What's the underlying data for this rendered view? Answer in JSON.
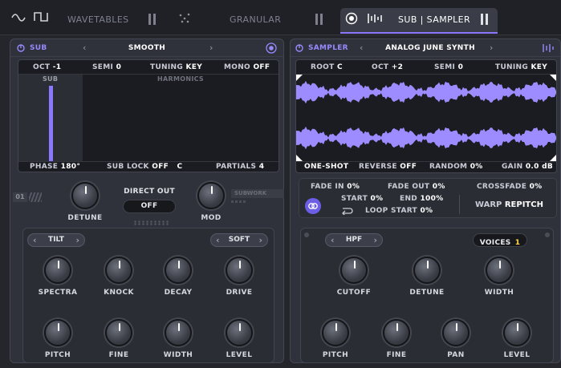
{
  "tabs": {
    "wavetables": "WAVETABLES",
    "granular": "GRANULAR",
    "sub_sampler": "SUB | SAMPLER"
  },
  "sub": {
    "title": "SUB",
    "preset": "SMOOTH",
    "oct_label": "OCT",
    "oct": "-1",
    "semi_label": "SEMI",
    "semi": "0",
    "tuning_label": "TUNING",
    "tuning": "KEY",
    "mono_label": "MONO",
    "mono": "OFF",
    "sub_label": "SUB",
    "harmonics_label": "HARMONICS",
    "phase_label": "PHASE",
    "phase": "180°",
    "sublock_label": "SUB LOCK",
    "sublock": "OFF",
    "sublock_key": "C",
    "partials_label": "PARTIALS",
    "partials": "4",
    "detune": "DETUNE",
    "direct_out": "DIRECT OUT",
    "direct_out_value": "OFF",
    "mod": "MOD",
    "slot": "01",
    "subwork": "SUBWORK"
  },
  "sub_fx": {
    "filter": "TILT",
    "shape": "SOFT",
    "knobs1": [
      "SPECTRA",
      "KNOCK",
      "DECAY",
      "DRIVE"
    ],
    "knobs2": [
      "PITCH",
      "FINE",
      "WIDTH",
      "LEVEL"
    ]
  },
  "sampler": {
    "title": "SAMPLER",
    "preset": "ANALOG JUNE SYNTH",
    "root_label": "ROOT",
    "root": "C",
    "oct_label": "OCT",
    "oct": "+2",
    "semi_label": "SEMI",
    "semi": "0",
    "tuning_label": "TUNING",
    "tuning": "KEY",
    "oneshot": "ONE-SHOT",
    "reverse_label": "REVERSE",
    "reverse": "OFF",
    "random_label": "RANDOM",
    "random": "0%",
    "gain_label": "GAIN",
    "gain": "0.0 dB",
    "fadein_label": "FADE IN",
    "fadein": "0%",
    "fadeout_label": "FADE OUT",
    "fadeout": "0%",
    "crossfade_label": "CROSSFADE",
    "crossfade": "0%",
    "start_label": "START",
    "start": "0%",
    "end_label": "END",
    "end": "100%",
    "loopstart_label": "LOOP START",
    "loopstart": "0%",
    "warp_label": "WARP",
    "warp": "REPITCH"
  },
  "sampler_fx": {
    "filter": "HPF",
    "voices_label": "VOICES",
    "voices": "1",
    "knobs1": [
      "CUTOFF",
      "DETUNE",
      "WIDTH"
    ],
    "knobs2": [
      "PITCH",
      "FINE",
      "PAN",
      "LEVEL"
    ]
  },
  "colors": {
    "accent": "#8a78ff",
    "waveform": "#9d8cff"
  }
}
